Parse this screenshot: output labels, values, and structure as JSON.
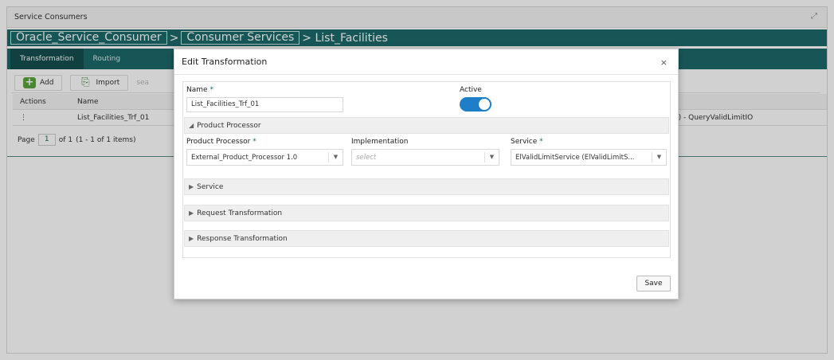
{
  "window": {
    "title": "Service Consumers",
    "expand_icon": "expand-icon"
  },
  "breadcrumb": {
    "items": [
      "Oracle_Service_Consumer",
      "Consumer Services"
    ],
    "separator": ">",
    "current": "> List_Facilities"
  },
  "tabs": [
    {
      "label": "Transformation",
      "active": true
    },
    {
      "label": "Routing",
      "active": false
    }
  ],
  "toolbar": {
    "add_label": "Add",
    "import_label": "Import",
    "search_fragment": "sea"
  },
  "table": {
    "columns": [
      "Actions",
      "Name"
    ],
    "rows": [
      {
        "action_glyph": "⋮",
        "name": "List_Facilities_Trf_01",
        "extra": "I) - QueryValidLimitIO"
      }
    ]
  },
  "pager": {
    "page_label": "Page",
    "page_value": "1",
    "of_label": "of 1",
    "items_label": "(1 - 1 of 1 items)"
  },
  "modal": {
    "title": "Edit Transformation",
    "close_glyph": "×",
    "name_label": "Name",
    "name_value": "List_Facilities_Trf_01",
    "active_label": "Active",
    "active": true,
    "required_mark": "*",
    "sections": {
      "product_processor": "Product Processor",
      "service": "Service",
      "request_transformation": "Request Transformation",
      "response_transformation": "Response Transformation"
    },
    "fields": {
      "product_processor_label": "Product Processor",
      "product_processor_value": "External_Product_Processor 1.0",
      "implementation_label": "Implementation",
      "implementation_placeholder": "select",
      "service_label": "Service",
      "service_value": "ElValidLimitService (ElValidLimitS..."
    },
    "save_label": "Save"
  },
  "colors": {
    "brand": "#1d6a6b",
    "toggle": "#1e7ec8",
    "add_green": "#5aa73c"
  }
}
